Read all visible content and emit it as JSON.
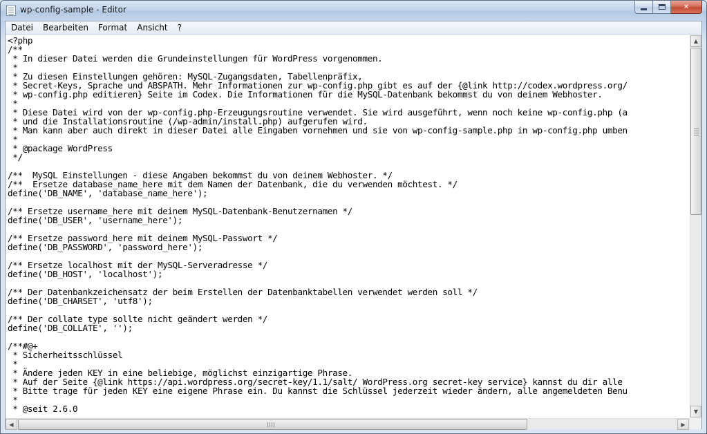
{
  "window": {
    "title": "wp-config-sample - Editor",
    "controls": {
      "minimize": "minimize",
      "maximize": "maximize",
      "close": "✕"
    }
  },
  "menu": [
    "Datei",
    "Bearbeiten",
    "Format",
    "Ansicht",
    "?"
  ],
  "editor": {
    "lines": [
      "<?php",
      "/**",
      " * In dieser Datei werden die Grundeinstellungen für WordPress vorgenommen.",
      " *",
      " * Zu diesen Einstellungen gehören: MySQL-Zugangsdaten, Tabellenpräfix,",
      " * Secret-Keys, Sprache und ABSPATH. Mehr Informationen zur wp-config.php gibt es auf der {@link http://codex.wordpress.org/",
      " * wp-config.php editieren} Seite im Codex. Die Informationen für die MySQL-Datenbank bekommst du von deinem Webhoster.",
      " *",
      " * Diese Datei wird von der wp-config.php-Erzeugungsroutine verwendet. Sie wird ausgeführt, wenn noch keine wp-config.php (a",
      " * und die Installationsroutine (/wp-admin/install.php) aufgerufen wird.",
      " * Man kann aber auch direkt in dieser Datei alle Eingaben vornehmen und sie von wp-config-sample.php in wp-config.php umben",
      " *",
      " * @package WordPress",
      " */",
      "",
      "/**  MySQL Einstellungen - diese Angaben bekommst du von deinem Webhoster. */",
      "/**  Ersetze database_name_here mit dem Namen der Datenbank, die du verwenden möchtest. */",
      "define('DB_NAME', 'database_name_here');",
      "",
      "/** Ersetze username_here mit deinem MySQL-Datenbank-Benutzernamen */",
      "define('DB_USER', 'username_here');",
      "",
      "/** Ersetze password_here mit deinem MySQL-Passwort */",
      "define('DB_PASSWORD', 'password_here');",
      "",
      "/** Ersetze localhost mit der MySQL-Serveradresse */",
      "define('DB_HOST', 'localhost');",
      "",
      "/** Der Datenbankzeichensatz der beim Erstellen der Datenbanktabellen verwendet werden soll */",
      "define('DB_CHARSET', 'utf8');",
      "",
      "/** Der collate type sollte nicht geändert werden */",
      "define('DB_COLLATE', '');",
      "",
      "/**#@+",
      " * Sicherheitsschlüssel",
      " *",
      " * Ändere jeden KEY in eine beliebige, möglichst einzigartige Phrase.",
      " * Auf der Seite {@link https://api.wordpress.org/secret-key/1.1/salt/ WordPress.org secret-key service} kannst du dir alle",
      " * Bitte trage für jeden KEY eine eigene Phrase ein. Du kannst die Schlüssel jederzeit wieder ändern, alle angemeldeten Benu",
      " *",
      " * @seit 2.6.0"
    ]
  }
}
